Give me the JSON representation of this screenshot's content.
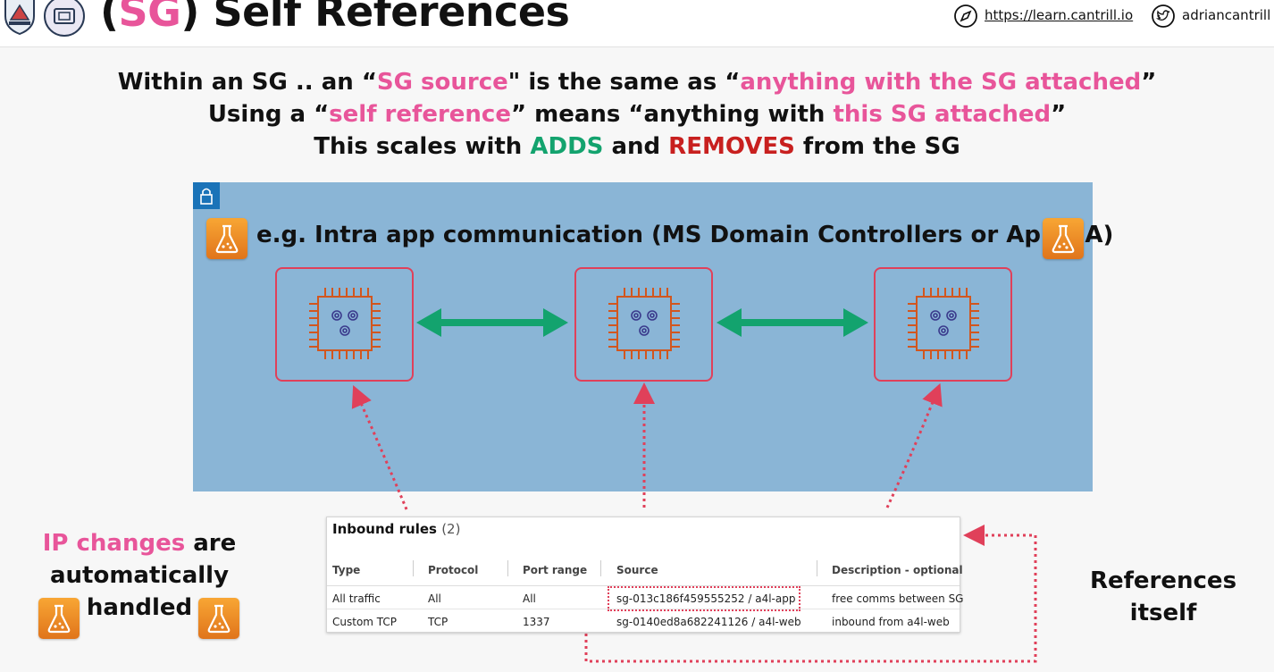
{
  "header": {
    "title_paren_open": "(",
    "title_sg": "SG",
    "title_rest": ") Self References",
    "site_link": "https://learn.cantrill.io",
    "twitter_handle": "adriancantrill",
    "icons": [
      "shield-logo-icon",
      "lab-logo-icon",
      "compass-icon",
      "twitter-icon"
    ]
  },
  "headline": {
    "line1": {
      "p1": "Within an SG .. an “",
      "p2": "SG source",
      "p3": "\" is the same as “",
      "p4": "anything with the SG attached",
      "p5": "”"
    },
    "line2": {
      "p1": "Using a “",
      "p2": "self reference",
      "p3": "” means “anything with ",
      "p4": "this SG attached",
      "p5": "”"
    },
    "line3": {
      "p1": "This scales with ",
      "p2": "ADDS",
      "p3": " and ",
      "p4": "REMOVES",
      "p5": " from the SG"
    }
  },
  "diagram": {
    "example_label": "e.g. Intra app communication (MS Domain Controllers or App HA)",
    "instances": [
      "ec2-instance-1",
      "ec2-instance-2",
      "ec2-instance-3"
    ],
    "colors": {
      "panel": "#8ab5d6",
      "arrow": "#13a36e",
      "instance_border": "#e0405a",
      "chip": "#d2561e",
      "flask": "#f39c2b"
    }
  },
  "inbound_rules": {
    "title": "Inbound rules",
    "count": "(2)",
    "columns": [
      "Type",
      "Protocol",
      "Port range",
      "Source",
      "Description - optional"
    ],
    "rows": [
      [
        "All traffic",
        "All",
        "All",
        "sg-013c186f459555252 / a4l-app",
        "free comms between SG"
      ],
      [
        "Custom TCP",
        "TCP",
        "1337",
        "sg-0140ed8a682241126 / a4l-web",
        "inbound from a4l-web"
      ]
    ]
  },
  "left_note": {
    "p1": "IP changes",
    "p2": " are",
    "line2": "automatically",
    "line3": "handled"
  },
  "right_note": {
    "line1": "References",
    "line2": "itself"
  }
}
